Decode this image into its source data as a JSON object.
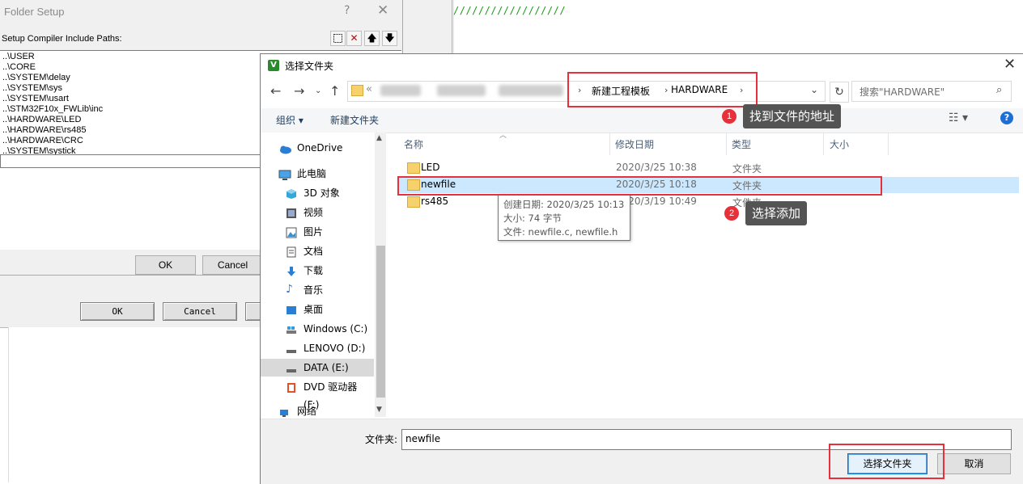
{
  "editor": {
    "comment_text": "//////////////////"
  },
  "options_dialog": {
    "ok_label": "OK",
    "cancel_label": "Cancel"
  },
  "folder_setup": {
    "title": "Folder Setup",
    "help_label": "?",
    "close_label": "✕",
    "subtitle": "Setup Compiler Include Paths:",
    "paths": [
      "..\\USER",
      "..\\CORE",
      "..\\SYSTEM\\delay",
      "..\\SYSTEM\\sys",
      "..\\SYSTEM\\usart",
      "..\\STM32F10x_FWLib\\inc",
      "..\\HARDWARE\\LED",
      "..\\HARDWARE\\rs485",
      "..\\HARDWARE\\CRC",
      "..\\SYSTEM\\systick"
    ],
    "ok_label": "OK",
    "cancel_label": "Cancel"
  },
  "file_dialog": {
    "title": "选择文件夹",
    "address": {
      "prefix": "«",
      "segments": [
        "新建工程模板",
        "HARDWARE"
      ]
    },
    "search_placeholder": "搜索\"HARDWARE\"",
    "toolbar": {
      "organize": "组织 ▾",
      "new_folder": "新建文件夹"
    },
    "nav_items": [
      {
        "label": "OneDrive",
        "icon": "cloud-icon"
      },
      {
        "label": "此电脑",
        "icon": "computer-icon"
      },
      {
        "label": "3D 对象",
        "icon": "cube-icon"
      },
      {
        "label": "视频",
        "icon": "video-icon"
      },
      {
        "label": "图片",
        "icon": "picture-icon"
      },
      {
        "label": "文档",
        "icon": "document-icon"
      },
      {
        "label": "下载",
        "icon": "download-icon"
      },
      {
        "label": "音乐",
        "icon": "music-icon"
      },
      {
        "label": "桌面",
        "icon": "desktop-icon"
      },
      {
        "label": "Windows (C:)",
        "icon": "drive-icon"
      },
      {
        "label": "LENOVO (D:)",
        "icon": "drive-icon"
      },
      {
        "label": "DATA (E:)",
        "icon": "drive-icon"
      },
      {
        "label": "DVD 驱动器 (F:)",
        "icon": "dvd-icon"
      },
      {
        "label": "网络",
        "icon": "network-icon"
      }
    ],
    "columns": [
      "名称",
      "修改日期",
      "类型",
      "大小"
    ],
    "files": [
      {
        "name": "LED",
        "date": "2020/3/25 10:38",
        "type": "文件夹"
      },
      {
        "name": "newfile",
        "date": "2020/3/25 10:18",
        "type": "文件夹"
      },
      {
        "name": "rs485",
        "date": "2020/3/19 10:49",
        "type": "文件夹"
      }
    ],
    "tooltip": {
      "created": "创建日期: 2020/3/25 10:13",
      "size": "大小: 74 字节",
      "files": "文件: newfile.c, newfile.h"
    },
    "folder_label": "文件夹:",
    "folder_value": "newfile",
    "select_button": "选择文件夹",
    "cancel_button": "取消"
  },
  "annotations": [
    {
      "number": "1",
      "label": "找到文件的地址"
    },
    {
      "number": "2",
      "label": "选择添加"
    }
  ],
  "colors": {
    "annotation_red": "#e8303a",
    "selection_blue": "#cce8ff",
    "accent_blue": "#0078d7"
  }
}
